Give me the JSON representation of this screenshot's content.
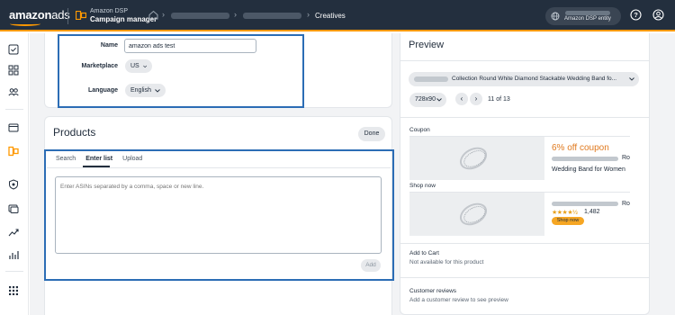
{
  "header": {
    "logo_main": "amazon",
    "logo_ads": "ads",
    "app_line1": "Amazon DSP",
    "app_line2": "Campaign manager",
    "current_crumb": "Creatives",
    "entity_label": "Amazon DSP entity",
    "colors": {
      "bar": "#232f3e",
      "accent": "#ff9900"
    }
  },
  "details": {
    "name_label": "Name",
    "name_value": "amazon ads test",
    "marketplace_label": "Marketplace",
    "marketplace_value": "US",
    "language_label": "Language",
    "language_value": "English"
  },
  "products": {
    "title": "Products",
    "done_label": "Done",
    "tabs": [
      "Search",
      "Enter list",
      "Upload"
    ],
    "active_tab": "Enter list",
    "asin_placeholder": "Enter ASINs separated by a comma, space or new line.",
    "add_label": "Add"
  },
  "preview": {
    "title": "Preview",
    "product_name": "Collection Round White Diamond Stackable Wedding Band fo...",
    "size": "728x90",
    "page_count": "11 of 13",
    "coupon_label": "Coupon",
    "coupon_text": "6% off coupon",
    "partial_name_1": "Ro",
    "product_subtitle": "Wedding Band for Women",
    "shop_now_label": "Shop now",
    "partial_name_2": "Ro",
    "stars": "★★★★½",
    "rating_count": "1,482",
    "shop_now_button": "Shop now",
    "add_to_cart_title": "Add to Cart",
    "add_to_cart_sub": "Not available for this product",
    "customer_reviews_title": "Customer reviews",
    "customer_reviews_sub": "Add a customer review to see preview"
  }
}
